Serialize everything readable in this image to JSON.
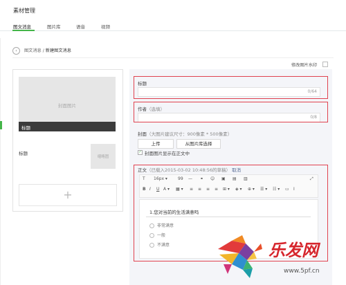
{
  "page": {
    "title": "素材管理"
  },
  "tabs": [
    {
      "label": "图文消息",
      "active": true
    },
    {
      "label": "图片库",
      "active": false
    },
    {
      "label": "语音",
      "active": false
    },
    {
      "label": "视频",
      "active": false
    }
  ],
  "breadcrumb": {
    "parent": "图文消息",
    "separator": "/",
    "current": "新建图文消息"
  },
  "watermark": {
    "label": "修改图片水印"
  },
  "left": {
    "cover_placeholder": "封面图片",
    "cover_caption": "标题",
    "item_title": "标题",
    "thumb_placeholder": "缩略图",
    "add_symbol": "+"
  },
  "form": {
    "title_label": "标题",
    "title_count": "0/64",
    "author_label": "作者",
    "author_hint": "（选填）",
    "author_count": "0/8",
    "cover_label": "封面",
    "cover_hint": "（大图片建议尺寸：900像素 * 500像素）",
    "upload_button": "上传",
    "library_button": "从图片库选择",
    "cover_in_body": "封面图片显示在正文中",
    "body_label": "正文",
    "body_status": "（已载入2015-03-02 10:48:56的草稿）",
    "cancel_link": "取消"
  },
  "toolbar": {
    "row1": [
      "T",
      "16px ▾",
      "99",
      "—",
      "⚭",
      "☺",
      "▣",
      "▤",
      "▥",
      "⤢"
    ],
    "row2": [
      "B",
      "I",
      "U",
      "A ▾",
      "▦ ▾",
      "≡",
      "≡",
      "≡",
      "≡",
      "⊞ ▾",
      "◈ ▾",
      "⊕ ▾",
      "☰ ▾",
      "☷ ▾",
      "▭",
      "I"
    ]
  },
  "survey": {
    "question": "1.您对当前的生活满意吗",
    "options": [
      "非常满意",
      "一般",
      "不满意"
    ]
  },
  "logo": {
    "brand": "乐发网",
    "url": "www.5pf.cn"
  },
  "colors": {
    "accent": "#44b549",
    "highlight_border": "#e0424f",
    "link": "#576b95"
  }
}
